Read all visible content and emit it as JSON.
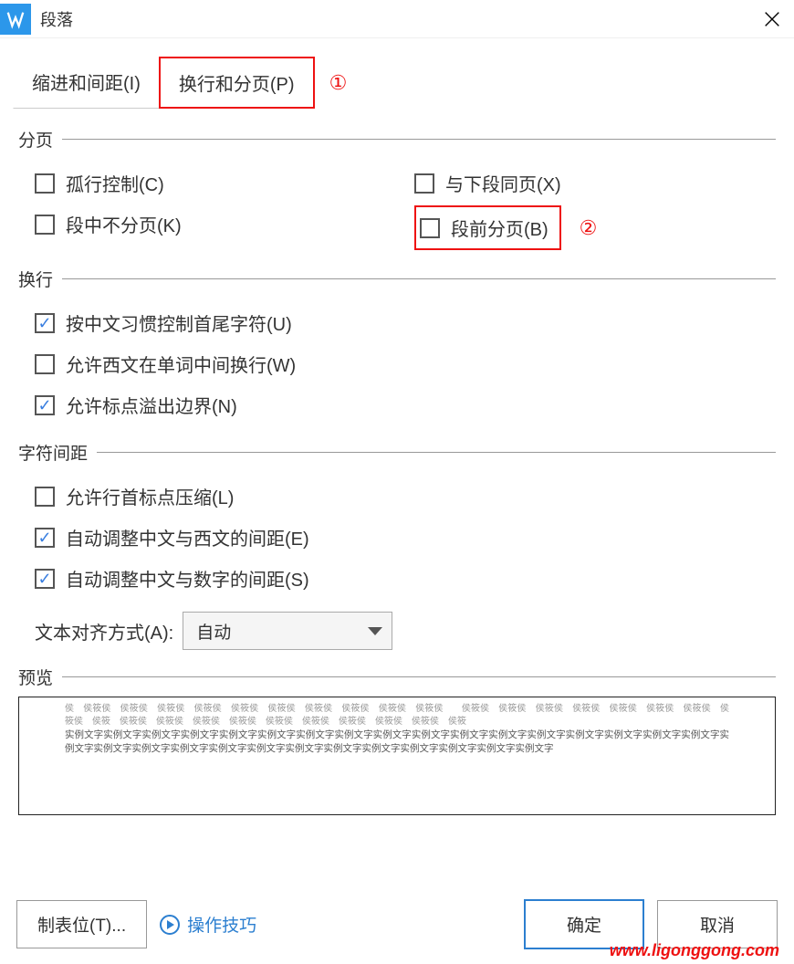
{
  "window": {
    "title": "段落"
  },
  "tabs": {
    "indent": "缩进和间距(I)",
    "pagebreak": "换行和分页(P)",
    "marker1": "①"
  },
  "sections": {
    "pagination": {
      "title": "分页",
      "widow_control": "孤行控制(C)",
      "keep_with_next": "与下段同页(X)",
      "keep_lines": "段中不分页(K)",
      "page_break_before": "段前分页(B)",
      "marker2": "②"
    },
    "linebreak": {
      "title": "换行",
      "chinese_rules": "按中文习惯控制首尾字符(U)",
      "allow_latin": "允许西文在单词中间换行(W)",
      "punctuation_overflow": "允许标点溢出边界(N)"
    },
    "spacing": {
      "title": "字符间距",
      "compress_punct": "允许行首标点压缩(L)",
      "adjust_cjk_latin": "自动调整中文与西文的间距(E)",
      "adjust_cjk_number": "自动调整中文与数字的间距(S)",
      "align_label": "文本对齐方式(A):",
      "align_value": "自动"
    },
    "preview": {
      "title": "预览",
      "placeholder_light": "侯　侯筱侯　侯筱侯　侯筱侯　侯筱侯　侯筱侯　侯筱侯　侯筱侯　侯筱侯　侯筱侯　侯筱侯　　侯筱侯　侯筱侯　侯筱侯　侯筱侯　侯筱侯　侯筱侯　侯筱侯　侯筱侯　侯筱　侯筱侯　侯筱侯　侯筱侯　侯筱侯　侯筱侯　侯筱侯　侯筱侯　侯筱侯　侯筱侯　侯筱",
      "placeholder_dark": "实例文字实例文字实例文字实例文字实例文字实例文字实例文字实例文字实例文字实例文字实例文字实例文字实例文字实例文字实例文字实例文字实例文字实例文字实例文字实例文字实例文字实例文字实例文字实例文字实例文字实例文字实例文字实例文字实例文字实例文字"
    }
  },
  "footer": {
    "tabs_button": "制表位(T)...",
    "tips": "操作技巧",
    "ok": "确定",
    "cancel": "取消"
  },
  "watermark": "www.ligonggong.com"
}
